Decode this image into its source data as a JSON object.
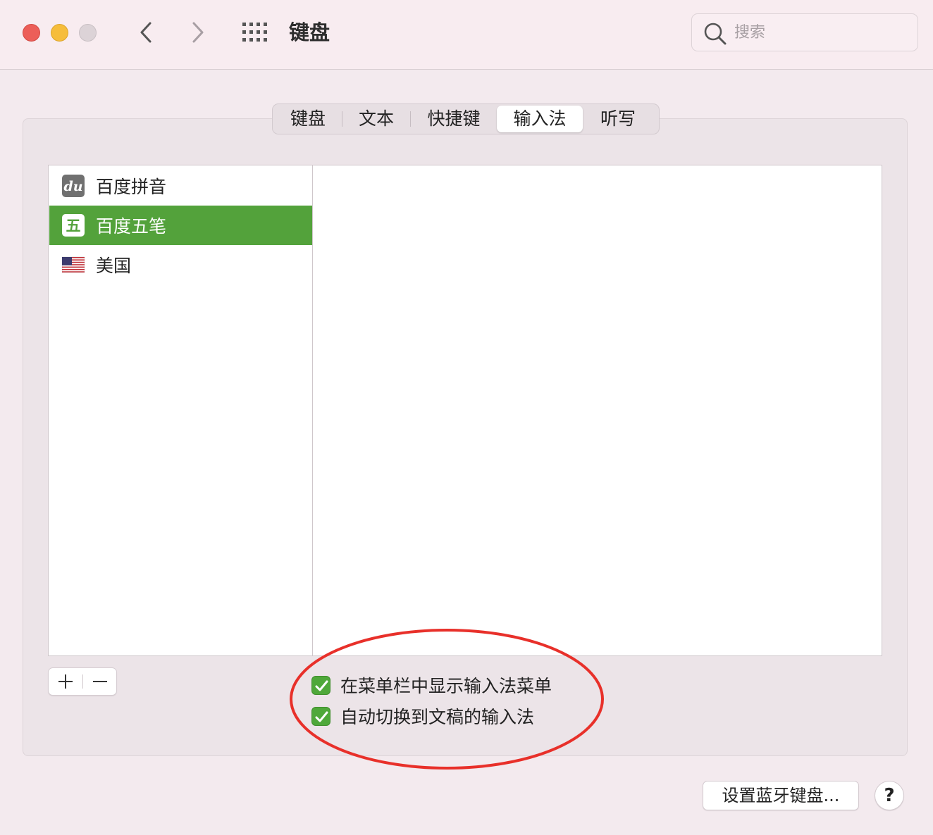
{
  "window": {
    "title": "键盘"
  },
  "search": {
    "placeholder": "搜索"
  },
  "tabs": [
    {
      "label": "键盘",
      "active": false
    },
    {
      "label": "文本",
      "active": false
    },
    {
      "label": "快捷键",
      "active": false
    },
    {
      "label": "输入法",
      "active": true
    },
    {
      "label": "听写",
      "active": false
    }
  ],
  "input_sources": [
    {
      "label": "百度拼音",
      "icon": "baidu-pinyin-icon",
      "selected": false
    },
    {
      "label": "百度五笔",
      "icon": "baidu-wubi-icon",
      "icon_text": "五",
      "selected": true
    },
    {
      "label": "美国",
      "icon": "us-flag-icon",
      "selected": false
    }
  ],
  "list_controls": {
    "add": "+",
    "remove": "−"
  },
  "options": [
    {
      "label": "在菜单栏中显示输入法菜单",
      "checked": true
    },
    {
      "label": "自动切换到文稿的输入法",
      "checked": true
    }
  ],
  "buttons": {
    "bluetooth": "设置蓝牙键盘...",
    "help": "?"
  },
  "colors": {
    "selection": "#53a23b",
    "checkbox": "#4fa83a",
    "annotation": "#e8302a",
    "close": "#ec5e58",
    "minimize": "#f6bd3b"
  }
}
